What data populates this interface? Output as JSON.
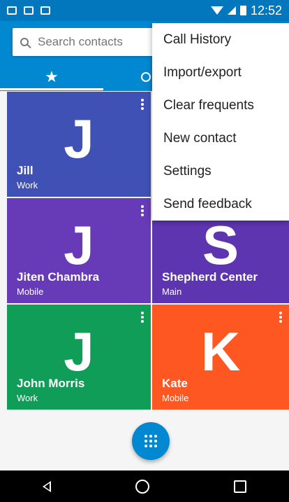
{
  "status_bar": {
    "time": "12:52"
  },
  "search": {
    "placeholder": "Search contacts"
  },
  "tabs": [
    {
      "name": "favorites",
      "icon": "star-icon"
    },
    {
      "name": "recents",
      "icon": "clock-icon"
    }
  ],
  "contacts": [
    {
      "letter": "J",
      "name": "Jill",
      "type": "Work",
      "color": "#3f51b5"
    },
    {
      "letter": "J",
      "name": "Jiten Chambra",
      "type": "Mobile",
      "color": "#673ab7"
    },
    {
      "letter": "S",
      "name": "Shepherd Center",
      "type": "Main",
      "color": "#5e35b1"
    },
    {
      "letter": "J",
      "name": "John Morris",
      "type": "Work",
      "color": "#0f9d58"
    },
    {
      "letter": "K",
      "name": "Kate",
      "type": "Mobile",
      "color": "#ff5722"
    }
  ],
  "menu": {
    "items": [
      "Call History",
      "Import/export",
      "Clear frequents",
      "New contact",
      "Settings",
      "Send feedback"
    ]
  },
  "colors": {
    "primary": "#0288d1",
    "status_bar": "#0277bd"
  }
}
